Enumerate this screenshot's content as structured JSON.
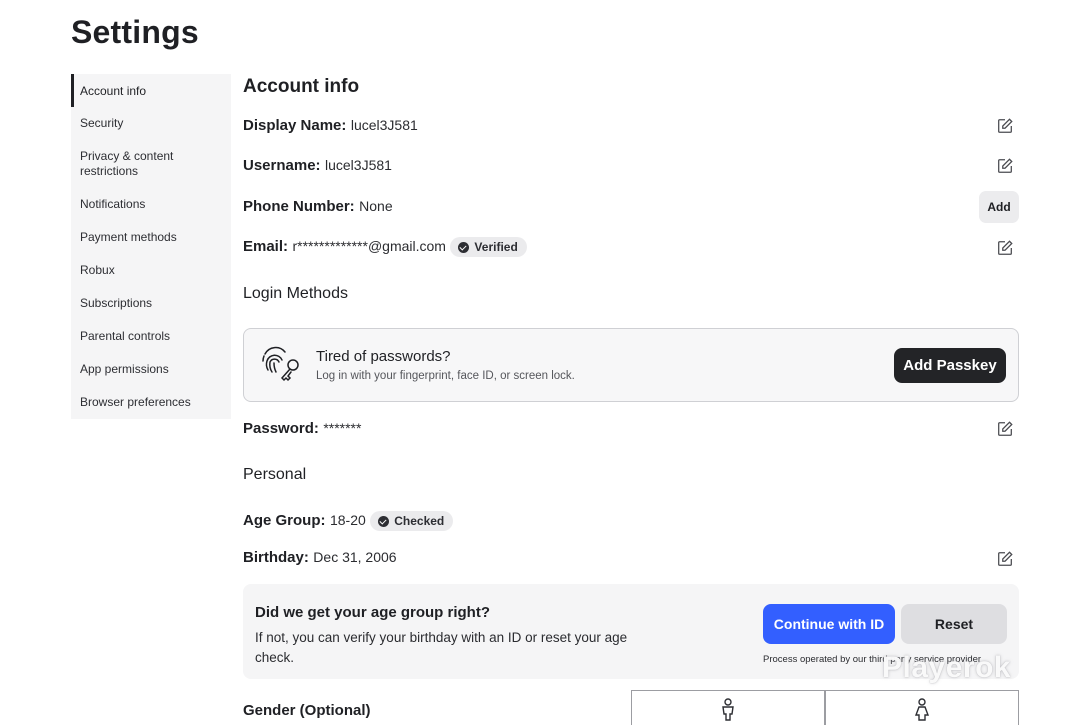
{
  "page": {
    "title": "Settings"
  },
  "sidebar": {
    "items": [
      {
        "label": "Account info",
        "active": true
      },
      {
        "label": "Security"
      },
      {
        "label": "Privacy & content restrictions"
      },
      {
        "label": "Notifications"
      },
      {
        "label": "Payment methods"
      },
      {
        "label": "Robux"
      },
      {
        "label": "Subscriptions"
      },
      {
        "label": "Parental controls"
      },
      {
        "label": "App permissions"
      },
      {
        "label": "Browser preferences"
      }
    ]
  },
  "account": {
    "heading": "Account info",
    "display_name": {
      "label": "Display Name:",
      "value": "lucel3J581"
    },
    "username": {
      "label": "Username:",
      "value": "lucel3J581"
    },
    "phone": {
      "label": "Phone Number:",
      "value": "None",
      "action": "Add"
    },
    "email": {
      "label": "Email:",
      "value": "r*************@gmail.com",
      "badge": "Verified"
    },
    "login_methods": {
      "heading": "Login Methods",
      "passkey": {
        "title": "Tired of passwords?",
        "subtitle": "Log in with your fingerprint, face ID, or screen lock.",
        "button": "Add Passkey"
      },
      "password": {
        "label": "Password:",
        "value": "*******"
      }
    },
    "personal": {
      "heading": "Personal",
      "age_group": {
        "label": "Age Group:",
        "value": "18-20",
        "badge": "Checked"
      },
      "birthday": {
        "label": "Birthday:",
        "value": "Dec 31, 2006"
      },
      "age_check": {
        "title": "Did we get your age group right?",
        "body": "If not, you can verify your birthday with an ID or reset your age check.",
        "primary_button": "Continue with ID",
        "secondary_button": "Reset",
        "note": "Process operated by our third party service provider"
      },
      "gender": {
        "label": "Gender (Optional)"
      }
    }
  },
  "watermark": "Playerok",
  "colors": {
    "primary": "#335fff",
    "dark_button": "#232427",
    "sidebar_bg": "#f5f5f6",
    "badge_bg": "#ebebed"
  },
  "icons": [
    "edit-icon",
    "fingerprint-key-icon",
    "check-circle-icon",
    "male-icon",
    "female-icon"
  ]
}
